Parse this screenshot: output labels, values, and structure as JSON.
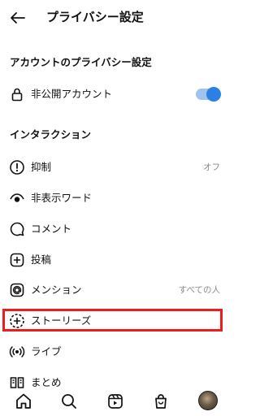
{
  "header": {
    "title": "プライバシー設定",
    "back_icon": "arrow-left-icon"
  },
  "account_section": {
    "heading": "アカウントのプライバシー設定",
    "private_account": {
      "label": "非公開アカウント",
      "icon": "lock-icon",
      "toggle_on": true
    }
  },
  "interaction_section": {
    "heading": "インタラクション",
    "items": [
      {
        "label": "抑制",
        "value": "オフ",
        "icon": "restrict-icon"
      },
      {
        "label": "非表示ワード",
        "value": "",
        "icon": "eye-hidden-icon"
      },
      {
        "label": "コメント",
        "value": "",
        "icon": "comment-icon"
      },
      {
        "label": "投稿",
        "value": "",
        "icon": "post-plus-icon"
      },
      {
        "label": "メンション",
        "value": "すべての人",
        "icon": "at-icon"
      },
      {
        "label": "ストーリーズ",
        "value": "",
        "icon": "story-plus-icon"
      },
      {
        "label": "ライブ",
        "value": "",
        "icon": "live-icon"
      },
      {
        "label": "まとめ",
        "value": "",
        "icon": "guide-icon"
      }
    ]
  },
  "tabbar": [
    "home-icon",
    "search-icon",
    "reels-icon",
    "shop-icon",
    "profile-avatar"
  ],
  "colors": {
    "accent": "#2b7fe5",
    "toggle_track": "#9fc3ee",
    "highlight": "#ee1c1c",
    "secondary_text": "#8a8a8a"
  }
}
